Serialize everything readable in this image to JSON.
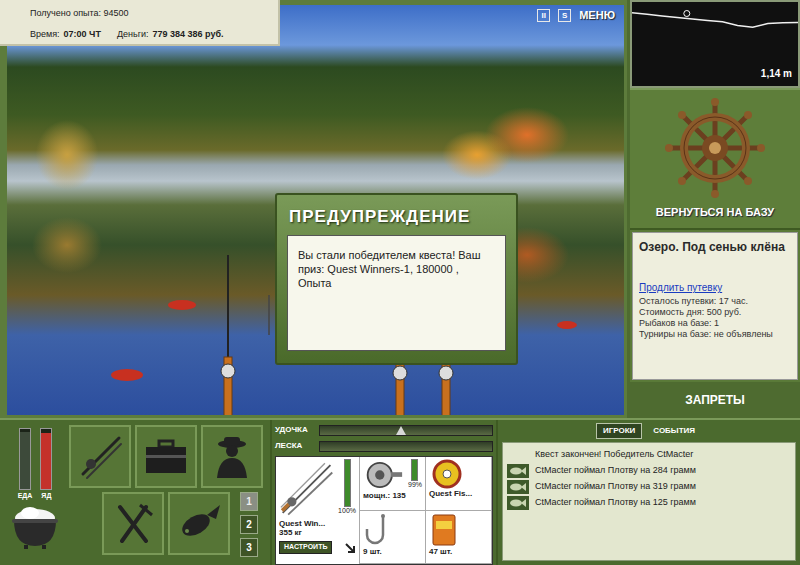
{
  "hud": {
    "experience": {
      "label": "Получено опыта:",
      "value": "94500"
    },
    "time": {
      "label": "Время:",
      "value": "07:00 ЧТ"
    },
    "money": {
      "label": "Деньги:",
      "value": "779 384 386 руб."
    }
  },
  "controls": {
    "pause": "II",
    "sound": "S",
    "menu": "МЕНЮ"
  },
  "dialog": {
    "title": "ПРЕДУПРЕЖДЕНИЕ",
    "message": "Вы стали победителем квеста! Ваш приз: Quest Winners-1, 180000 , Опыта"
  },
  "depth_chart": {
    "reading": "1,14 m",
    "profile": [
      0.6,
      0.68,
      0.78,
      0.86,
      0.95,
      1.02,
      1.1,
      1.3,
      1.4,
      1.2,
      1.15,
      1.14
    ],
    "marker": {
      "level": 0.33
    }
  },
  "base": {
    "button": "ВЕРНУТЬСЯ НА БАЗУ",
    "location": "Озеро. Под сенью клёна",
    "extend_link": "Продлить путевку",
    "details": [
      "Осталось путевки: 17 час.",
      "Стоимость дня: 500 руб.",
      "Рыбаков на базе: 1",
      "Турниры на базе: не объявлены"
    ],
    "bans": "ЗАПРЕТЫ"
  },
  "needs": [
    {
      "label": "ЕДА",
      "level": 0.95,
      "color": "#3d4a3a"
    },
    {
      "label": "ЯД",
      "level": 0.93,
      "color": "#c4312b"
    }
  ],
  "rod_slots": [
    {
      "label": "1",
      "selected": true
    },
    {
      "label": "2",
      "selected": false
    },
    {
      "label": "3",
      "selected": false
    }
  ],
  "tension": [
    {
      "label": "УДОЧКА",
      "level": 0.47
    },
    {
      "label": "ЛЕСКА",
      "level": 0
    }
  ],
  "tackle": {
    "rod": {
      "name": "Quest Win...",
      "load": "355 кг",
      "condition": "100%",
      "level": 1,
      "button": "НАСТРОИТЬ"
    },
    "reel": {
      "power": "мощн.: 135",
      "condition": "99%",
      "level": 0.99
    },
    "line": {
      "name": "Quest Fis..."
    },
    "hook": {
      "count": "9 шт."
    },
    "bait": {
      "count": "47 шт."
    }
  },
  "log": {
    "tabs": [
      {
        "label": "ИГРОКИ",
        "selected": true
      },
      {
        "label": "СОБЫТИЯ",
        "selected": false
      }
    ],
    "entries": [
      {
        "kind": "system",
        "text": "Квест закончен! Победитель CtMacter"
      },
      {
        "kind": "catch",
        "text": "CtMacter поймал Плотву на 284 грамм"
      },
      {
        "kind": "catch",
        "text": "CtMacter поймал Плотву на 319 грамм"
      },
      {
        "kind": "catch",
        "text": "CtMacter поймал Плотву на 125 грамм"
      }
    ]
  }
}
